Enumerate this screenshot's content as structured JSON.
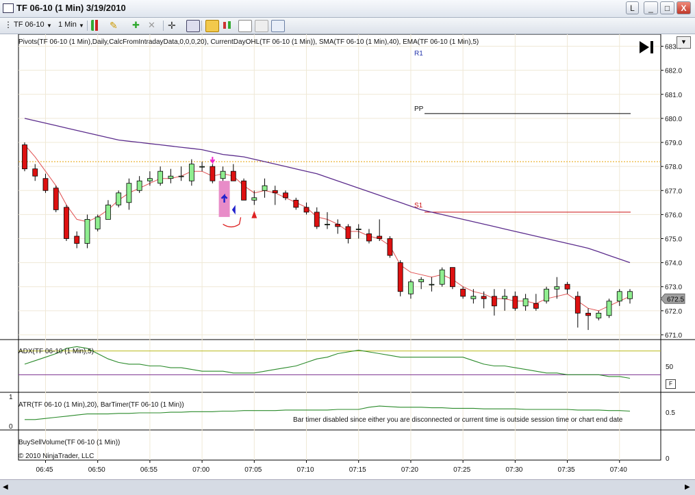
{
  "window": {
    "title": "TF 06-10 (1 Min)  3/19/2010",
    "min_label": "L",
    "buttons": [
      "_",
      "□",
      "X"
    ]
  },
  "toolbar": {
    "instrument": "TF 06-10",
    "interval": "1 Min"
  },
  "panels": {
    "price": {
      "label": "Pivots(TF 06-10 (1 Min),Daily,CalcFromIntradayData,0,0,0,20), CurrentDayOHL(TF 06-10 (1 Min)), SMA(TF 06-10 (1 Min),40), EMA(TF 06-10 (1 Min),5)",
      "pivots": {
        "R1": "R1",
        "PP": "PP",
        "S1": "S1"
      },
      "price_ticks": [
        "683.0",
        "682.0",
        "681.0",
        "680.0",
        "679.0",
        "678.0",
        "677.0",
        "676.0",
        "675.0",
        "674.0",
        "673.0",
        "672.0",
        "671.0"
      ],
      "last_price": "672.5"
    },
    "adx": {
      "label": "ADX(TF 06-10 (1 Min),5)",
      "tick": "50",
      "f_button": "F"
    },
    "atr": {
      "label": "ATR(TF 06-10 (1 Min),20), BarTimer(TF 06-10 (1 Min))",
      "message": "Bar timer disabled since either you are disconnected or current time is outside session time or chart end date",
      "left_ticks": [
        "1",
        "0"
      ],
      "right_tick": "0.5"
    },
    "volume": {
      "label": "BuySellVolume(TF 06-10 (1 Min))",
      "copyright": "© 2010 NinjaTrader, LLC",
      "right_tick": "0"
    }
  },
  "time_ticks": [
    "06:45",
    "06:50",
    "06:55",
    "07:00",
    "07:05",
    "07:10",
    "07:15",
    "07:20",
    "07:25",
    "07:30",
    "07:35",
    "07:40"
  ],
  "colors": {
    "up": "#90ee90",
    "down": "#dd1111",
    "sma": "#5b2c8c",
    "ema": "#e05050",
    "r1": "#2233aa",
    "pp": "#000000",
    "s1": "#cc1111",
    "ohl": "#e8a000",
    "adx": "#2a8a2a"
  },
  "chart_data": {
    "type": "candlestick",
    "x": [
      "06:43",
      "06:44",
      "06:45",
      "06:46",
      "06:47",
      "06:48",
      "06:49",
      "06:50",
      "06:51",
      "06:52",
      "06:53",
      "06:54",
      "06:55",
      "06:56",
      "06:57",
      "06:58",
      "06:59",
      "07:00",
      "07:01",
      "07:02",
      "07:03",
      "07:04",
      "07:05",
      "07:06",
      "07:07",
      "07:08",
      "07:09",
      "07:10",
      "07:11",
      "07:12",
      "07:13",
      "07:14",
      "07:15",
      "07:16",
      "07:17",
      "07:18",
      "07:19",
      "07:20",
      "07:21",
      "07:22",
      "07:23",
      "07:24",
      "07:25",
      "07:26",
      "07:27",
      "07:28",
      "07:29",
      "07:30",
      "07:31",
      "07:32",
      "07:33",
      "07:34",
      "07:35",
      "07:36",
      "07:37",
      "07:38",
      "07:39",
      "07:40",
      "07:41"
    ],
    "candles": [
      [
        678.9,
        679.0,
        677.8,
        677.9
      ],
      [
        677.9,
        678.1,
        677.4,
        677.6
      ],
      [
        677.5,
        677.7,
        676.9,
        677.0
      ],
      [
        677.1,
        677.2,
        676.1,
        676.2
      ],
      [
        676.3,
        676.4,
        674.9,
        675.0
      ],
      [
        675.1,
        675.3,
        674.6,
        674.8
      ],
      [
        674.8,
        676.0,
        674.6,
        675.8
      ],
      [
        675.4,
        676.0,
        675.3,
        675.9
      ],
      [
        675.8,
        676.6,
        675.8,
        676.4
      ],
      [
        676.4,
        677.0,
        676.3,
        676.9
      ],
      [
        676.5,
        677.5,
        676.2,
        677.3
      ],
      [
        677.0,
        677.6,
        676.9,
        677.4
      ],
      [
        677.4,
        677.8,
        677.2,
        677.5
      ],
      [
        677.3,
        678.0,
        677.2,
        677.8
      ],
      [
        677.5,
        677.9,
        677.3,
        677.6
      ],
      [
        677.6,
        678.0,
        677.4,
        677.6
      ],
      [
        677.4,
        678.3,
        677.2,
        678.1
      ],
      [
        678.0,
        678.2,
        677.8,
        678.0
      ],
      [
        678.0,
        678.1,
        677.3,
        677.4
      ],
      [
        677.5,
        678.0,
        677.4,
        677.8
      ],
      [
        677.8,
        678.1,
        677.4,
        677.4
      ],
      [
        677.4,
        677.5,
        676.6,
        676.6
      ],
      [
        676.6,
        677.0,
        676.4,
        676.7
      ],
      [
        677.0,
        677.5,
        676.7,
        677.2
      ],
      [
        677.0,
        677.2,
        676.4,
        676.9
      ],
      [
        676.9,
        677.0,
        676.6,
        676.7
      ],
      [
        676.6,
        676.7,
        676.2,
        676.3
      ],
      [
        676.3,
        676.5,
        676.0,
        676.1
      ],
      [
        676.1,
        676.3,
        675.4,
        675.5
      ],
      [
        675.6,
        676.1,
        675.4,
        675.6
      ],
      [
        675.6,
        675.8,
        675.2,
        675.5
      ],
      [
        675.5,
        675.6,
        674.8,
        675.0
      ],
      [
        675.4,
        675.6,
        675.0,
        675.4
      ],
      [
        675.2,
        675.4,
        674.8,
        674.9
      ],
      [
        675.1,
        675.8,
        674.9,
        675.0
      ],
      [
        675.0,
        675.1,
        674.2,
        674.3
      ],
      [
        674.0,
        674.1,
        672.6,
        672.8
      ],
      [
        672.7,
        673.3,
        672.5,
        673.2
      ],
      [
        673.2,
        673.4,
        672.9,
        673.3
      ],
      [
        673.1,
        673.4,
        672.8,
        673.1
      ],
      [
        673.1,
        673.8,
        673.0,
        673.7
      ],
      [
        673.8,
        673.8,
        672.9,
        673.0
      ],
      [
        672.9,
        673.0,
        672.5,
        672.6
      ],
      [
        672.5,
        672.9,
        672.3,
        672.6
      ],
      [
        672.6,
        672.8,
        672.1,
        672.5
      ],
      [
        672.6,
        672.9,
        671.8,
        672.2
      ],
      [
        672.5,
        672.9,
        672.0,
        672.6
      ],
      [
        672.6,
        672.8,
        672.0,
        672.1
      ],
      [
        672.2,
        672.7,
        672.0,
        672.5
      ],
      [
        672.3,
        672.7,
        672.0,
        672.1
      ],
      [
        672.4,
        673.0,
        672.3,
        672.9
      ],
      [
        672.9,
        673.4,
        672.5,
        673.0
      ],
      [
        673.1,
        673.2,
        672.7,
        672.9
      ],
      [
        672.6,
        672.8,
        671.3,
        671.9
      ],
      [
        671.9,
        672.1,
        671.2,
        671.8
      ],
      [
        671.7,
        672.0,
        671.6,
        671.9
      ],
      [
        671.8,
        672.5,
        671.7,
        672.4
      ],
      [
        672.4,
        672.9,
        672.2,
        672.8
      ],
      [
        672.5,
        672.9,
        672.3,
        672.8
      ]
    ],
    "sma": [
      680.0,
      679.9,
      679.8,
      679.7,
      679.6,
      679.5,
      679.4,
      679.3,
      679.2,
      679.1,
      679.05,
      679.0,
      678.95,
      678.9,
      678.85,
      678.8,
      678.75,
      678.7,
      678.6,
      678.5,
      678.45,
      678.4,
      678.3,
      678.2,
      678.1,
      678.0,
      677.9,
      677.8,
      677.7,
      677.55,
      677.4,
      677.25,
      677.1,
      676.95,
      676.8,
      676.65,
      676.5,
      676.35,
      676.2,
      676.1,
      676.0,
      675.9,
      675.8,
      675.7,
      675.6,
      675.5,
      675.4,
      675.3,
      675.2,
      675.1,
      675.0,
      674.9,
      674.8,
      674.7,
      674.6,
      674.45,
      674.3,
      674.15,
      674.0
    ],
    "ema": [
      678.9,
      678.4,
      677.8,
      677.2,
      676.4,
      675.8,
      675.7,
      675.9,
      676.2,
      676.6,
      676.9,
      677.1,
      677.3,
      677.5,
      677.5,
      677.6,
      677.8,
      677.8,
      677.6,
      677.7,
      677.6,
      677.2,
      676.9,
      677.0,
      676.9,
      676.7,
      676.5,
      676.3,
      675.9,
      675.8,
      675.6,
      675.3,
      675.3,
      675.1,
      675.0,
      674.7,
      673.9,
      673.6,
      673.5,
      673.4,
      673.5,
      673.3,
      673.0,
      672.8,
      672.7,
      672.5,
      672.5,
      672.4,
      672.4,
      672.3,
      672.5,
      672.6,
      672.7,
      672.4,
      672.1,
      672.0,
      672.2,
      672.4,
      672.6
    ],
    "pivots": {
      "R1": 683.6,
      "PP": 680.2,
      "S1": 676.1
    },
    "current_day_ohl_line": 678.2,
    "y_range": [
      670.8,
      683.5
    ],
    "adx": [
      46,
      48,
      50,
      52,
      55,
      56,
      55,
      52,
      49,
      47,
      46,
      46,
      45,
      45,
      44,
      44,
      43,
      42,
      42,
      42,
      41,
      41,
      41,
      42,
      43,
      44,
      45,
      47,
      49,
      50,
      52,
      53,
      54,
      53,
      52,
      51,
      50,
      50,
      50,
      50,
      50,
      50,
      50,
      48,
      46,
      45,
      45,
      44,
      43,
      42,
      41,
      41,
      40,
      40,
      40,
      40,
      39,
      39,
      38
    ],
    "atr": [
      0.6,
      0.6,
      0.62,
      0.64,
      0.66,
      0.68,
      0.7,
      0.7,
      0.7,
      0.71,
      0.71,
      0.72,
      0.72,
      0.72,
      0.73,
      0.73,
      0.74,
      0.74,
      0.74,
      0.75,
      0.75,
      0.76,
      0.76,
      0.76,
      0.76,
      0.77,
      0.77,
      0.77,
      0.77,
      0.77,
      0.78,
      0.78,
      0.78,
      0.82,
      0.84,
      0.83,
      0.82,
      0.82,
      0.82,
      0.81,
      0.81,
      0.8,
      0.8,
      0.8,
      0.79,
      0.79,
      0.79,
      0.79,
      0.78,
      0.78,
      0.78,
      0.78,
      0.78,
      0.77,
      0.77,
      0.77,
      0.76,
      0.76,
      0.75
    ]
  }
}
